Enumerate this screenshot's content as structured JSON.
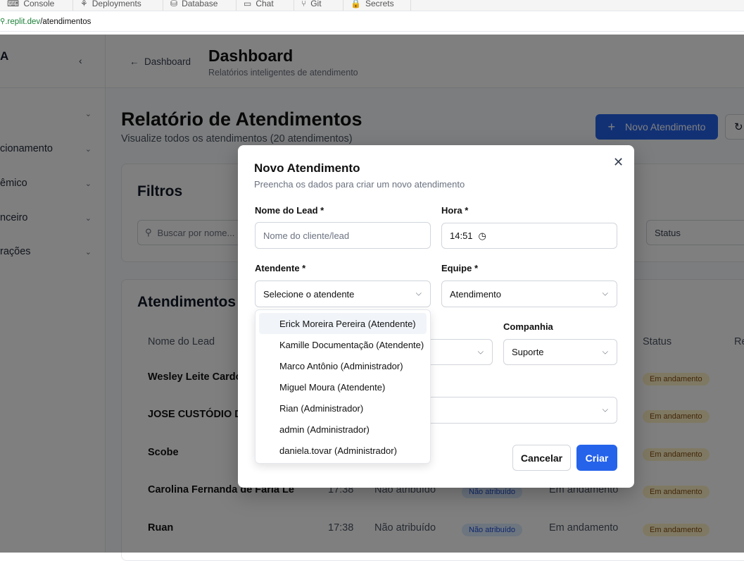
{
  "ide_tabs": [
    "Console",
    "Deployments",
    "Database",
    "Chat",
    "Git",
    "Secrets"
  ],
  "url": {
    "host": ".replit.dev",
    "path": "/atendimentos"
  },
  "sidebar": {
    "logo": "A",
    "collapse_icon": "chevron-left-icon",
    "items": [
      {
        "label": ""
      },
      {
        "label": "cionamento"
      },
      {
        "label": "êmico"
      },
      {
        "label": "nceiro"
      },
      {
        "label": "rações"
      }
    ]
  },
  "header": {
    "back_label": "Dashboard",
    "title": "Dashboard",
    "subtitle": "Relatórios inteligentes de atendimento"
  },
  "main": {
    "title": "Relatório de Atendimentos",
    "subtitle": "Visualize todos os atendimentos (20 atendimentos)",
    "new_button": "Novo Atendimento",
    "filters": {
      "title": "Filtros",
      "search_placeholder": "Buscar por nome...",
      "status_placeholder": "Status"
    },
    "table": {
      "title": "Atendimentos",
      "columns": [
        "Nome do Lead",
        "Status",
        "Re"
      ],
      "rows": [
        {
          "name": "Wesley Leite Cardo",
          "time": "",
          "attendant": "",
          "badge": "",
          "status": "",
          "status_badge": "Em andamento"
        },
        {
          "name": "JOSE CUSTÓDIO D",
          "time": "",
          "attendant": "",
          "badge": "",
          "status": "",
          "status_badge": "Em andamento"
        },
        {
          "name": "Scobe",
          "time": "",
          "attendant": "",
          "badge": "",
          "status": "",
          "status_badge": "Em andamento"
        },
        {
          "name": "Carolina Fernanda de Faria Le",
          "time": "17:38",
          "attendant": "Não atribuído",
          "badge": "Não atribuído",
          "status": "Em andamento",
          "status_badge": "Em andamento"
        },
        {
          "name": "Ruan",
          "time": "17:38",
          "attendant": "Não atribuído",
          "badge": "Não atribuído",
          "status": "Em andamento",
          "status_badge": "Em andamento"
        }
      ]
    }
  },
  "modal": {
    "title": "Novo Atendimento",
    "subtitle": "Preencha os dados para criar um novo atendimento",
    "lead_label": "Nome do Lead *",
    "lead_placeholder": "Nome do cliente/lead",
    "hora_label": "Hora *",
    "hora_value": "14:51",
    "atendente_label": "Atendente *",
    "atendente_placeholder": "Selecione o atendente",
    "equipe_label": "Equipe *",
    "equipe_value": "Atendimento",
    "companhia_label": "Companhia",
    "companhia_value": "Suporte",
    "cancel_label": "Cancelar",
    "create_label": "Criar",
    "atendente_options": [
      "Erick Moreira Pereira (Atendente)",
      "Kamille Documentação (Atendente)",
      "Marco Antônio (Administrador)",
      "Miguel Moura (Atendente)",
      "Rian (Administrador)",
      "admin (Administrador)",
      "daniela.tovar (Administrador)"
    ]
  }
}
